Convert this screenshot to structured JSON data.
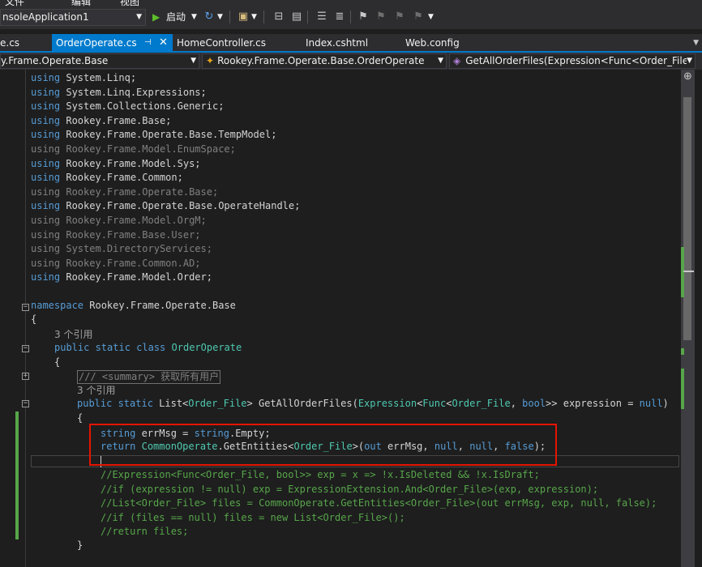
{
  "menu": {
    "frag1": "文件",
    "frag2": "编辑",
    "frag3": "视图"
  },
  "toolbar": {
    "project_combo": "nsoleApplication1",
    "start_label": "启动"
  },
  "tabs": [
    {
      "label": "e.cs",
      "active": false
    },
    {
      "label": "OrderOperate.cs",
      "active": true
    },
    {
      "label": "HomeController.cs",
      "active": false
    },
    {
      "label": "Index.cshtml",
      "active": false
    },
    {
      "label": "Web.config",
      "active": false
    }
  ],
  "navbar": {
    "project": "y.Frame.Operate.Base",
    "class": "Rookey.Frame.Operate.Base.OrderOperate",
    "member": "GetAllOrderFiles(Expression<Func<Order_File,"
  },
  "code": {
    "usings": [
      {
        "ns": "System.Linq;",
        "used": true
      },
      {
        "ns": "System.Linq.Expressions;",
        "used": true
      },
      {
        "ns": "System.Collections.Generic;",
        "used": true
      },
      {
        "ns": "Rookey.Frame.Base;",
        "used": true
      },
      {
        "ns": "Rookey.Frame.Operate.Base.TempModel;",
        "used": true
      },
      {
        "ns": "Rookey.Frame.Model.EnumSpace;",
        "used": false
      },
      {
        "ns": "Rookey.Frame.Model.Sys;",
        "used": true
      },
      {
        "ns": "Rookey.Frame.Common;",
        "used": true
      },
      {
        "ns": "Rookey.Frame.Operate.Base;",
        "used": false
      },
      {
        "ns": "Rookey.Frame.Operate.Base.OperateHandle;",
        "used": true
      },
      {
        "ns": "Rookey.Frame.Model.OrgM;",
        "used": false
      },
      {
        "ns": "Rookey.Frame.Base.User;",
        "used": false
      },
      {
        "ns": "System.DirectoryServices;",
        "used": false
      },
      {
        "ns": "Rookey.Frame.Common.AD;",
        "used": false
      },
      {
        "ns": "Rookey.Frame.Model.Order;",
        "used": true
      }
    ],
    "using_kw": "using",
    "namespace_kw": "namespace",
    "namespace_name": " Rookey.Frame.Operate.Base",
    "open_brace": "{",
    "close_brace": "}",
    "ref_count_class": "3 个引用",
    "ref_count_method": "3 个引用",
    "class_mods": "public static class",
    "class_name": "OrderOperate",
    "summary": "/// <summary> 获取所有用户",
    "method_mods": "public static",
    "method_sig_1": " List<",
    "method_sig_2": "Order_File",
    "method_sig_3": "> GetAllOrderFiles(",
    "method_sig_4": "Expression",
    "method_sig_5": "<",
    "method_sig_6": "Func",
    "method_sig_7": "<",
    "method_sig_8": "Order_File",
    "method_sig_9": ", ",
    "method_sig_10": "bool",
    "method_sig_11": ">> expression = ",
    "method_sig_12": "null",
    "method_sig_13": ")",
    "line_errmsg_1": "string",
    "line_errmsg_2": " errMsg = ",
    "line_errmsg_3": "string",
    "line_errmsg_4": ".Empty;",
    "line_return_1": "return",
    "line_return_2": " ",
    "line_return_3": "CommonOperate",
    "line_return_4": ".GetEntities<",
    "line_return_5": "Order_File",
    "line_return_6": ">(",
    "line_return_7": "out",
    "line_return_8": " errMsg, ",
    "line_return_9": "null",
    "line_return_10": ", ",
    "line_return_11": "null",
    "line_return_12": ", ",
    "line_return_13": "false",
    "line_return_14": ");",
    "comments": [
      "//Expression<Func<Order_File, bool>> exp = x => !x.IsDeleted && !x.IsDraft;",
      "//if (expression != null) exp = ExpressionExtension.And<Order_File>(exp, expression);",
      "//List<Order_File> files = CommonOperate.GetEntities<Order_File>(out errMsg, exp, null, false);",
      "//if (files == null) files = new List<Order_File>();",
      "//return files;"
    ]
  },
  "colors": {
    "keyword": "#569cd6",
    "type": "#4ec9b0",
    "comment": "#57a64a",
    "accent": "#007acc",
    "highlight_box": "#e51400"
  }
}
